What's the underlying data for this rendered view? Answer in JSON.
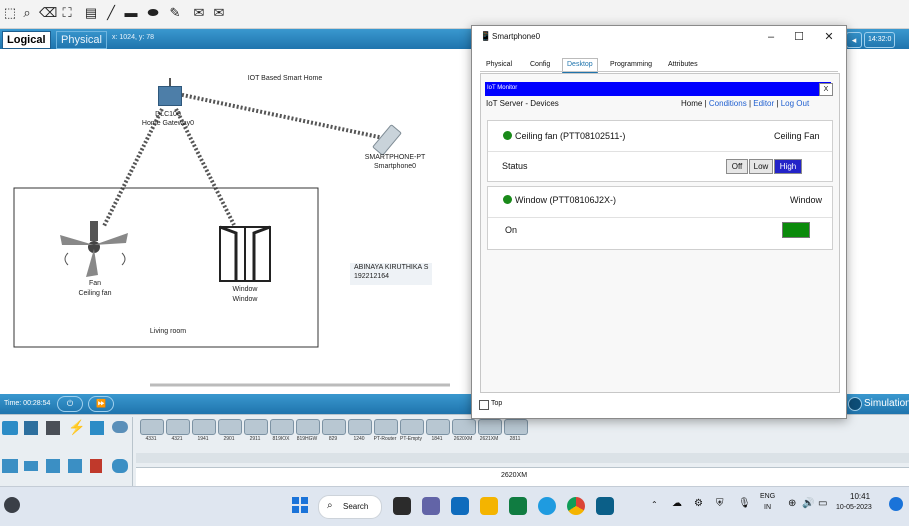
{
  "toolbar": {
    "icons": [
      "selection-icon",
      "search-icon",
      "delete-icon",
      "resize-icon",
      "note-icon",
      "line-icon",
      "rectangle-icon",
      "ellipse-icon",
      "freeform-icon",
      "pdu-icon",
      "complex-pdu-icon"
    ]
  },
  "modebar": {
    "logical_label": "Logical",
    "physical_label": "Physical",
    "coords": "x: 1024, y: 78",
    "right_time": "14:32:0"
  },
  "workspace": {
    "heading": "IOT Based Smart Home",
    "gateway_name": "DLC100",
    "gateway_label": "Home Gateway0",
    "phone_type": "SMARTPHONE-PT",
    "phone_name": "Smartphone0",
    "fan_name": "Fan",
    "fan_label": "Ceiling fan",
    "window_name": "Window",
    "window_label": "Window",
    "room_label": "Living room",
    "author_name": "ABINAYA KIRUTHIKA S",
    "author_id": "192212164"
  },
  "timebar": {
    "time": "Time: 00:28:54",
    "simulation": "Simulation"
  },
  "palette": {
    "device_labels": [
      "4331",
      "4321",
      "1941",
      "2901",
      "2911",
      "819IOX",
      "819HGW",
      "829",
      "1240",
      "PT-Router",
      "PT-Empty",
      "1841",
      "2620XM",
      "2621XM",
      "2811"
    ],
    "selected_model": "2620XM"
  },
  "taskbar": {
    "search_label": "Search",
    "lang1": "ENG",
    "lang2": "IN",
    "time": "10:41",
    "date": "10-05-2023"
  },
  "dialog": {
    "title": "Smartphone0",
    "tabs": [
      "Physical",
      "Config",
      "Desktop",
      "Programming",
      "Attributes"
    ],
    "active_tab": "Desktop",
    "monitor_title": "IoT Monitor",
    "monitor_close": "X",
    "server_label": "IoT Server - Devices",
    "nav": {
      "home": "Home",
      "sep": "|",
      "conditions": "Conditions",
      "editor": "Editor",
      "logout": "Log Out"
    },
    "devices": [
      {
        "name": "Ceiling fan (PTT08102511-)",
        "type": "Ceiling Fan",
        "prop_label": "Status",
        "options": [
          "Off",
          "Low",
          "High"
        ],
        "selected": "High"
      },
      {
        "name": "Window (PTT08106J2X-)",
        "type": "Window",
        "prop_label": "On",
        "state_color": "#0b8a0b"
      }
    ],
    "top_checkbox_label": "Top"
  },
  "colors": {
    "accent_blue": "#1f74ad",
    "monitor_bar": "#0000ff",
    "status_green": "#1a8a1a",
    "selected_option": "#2323c8"
  }
}
